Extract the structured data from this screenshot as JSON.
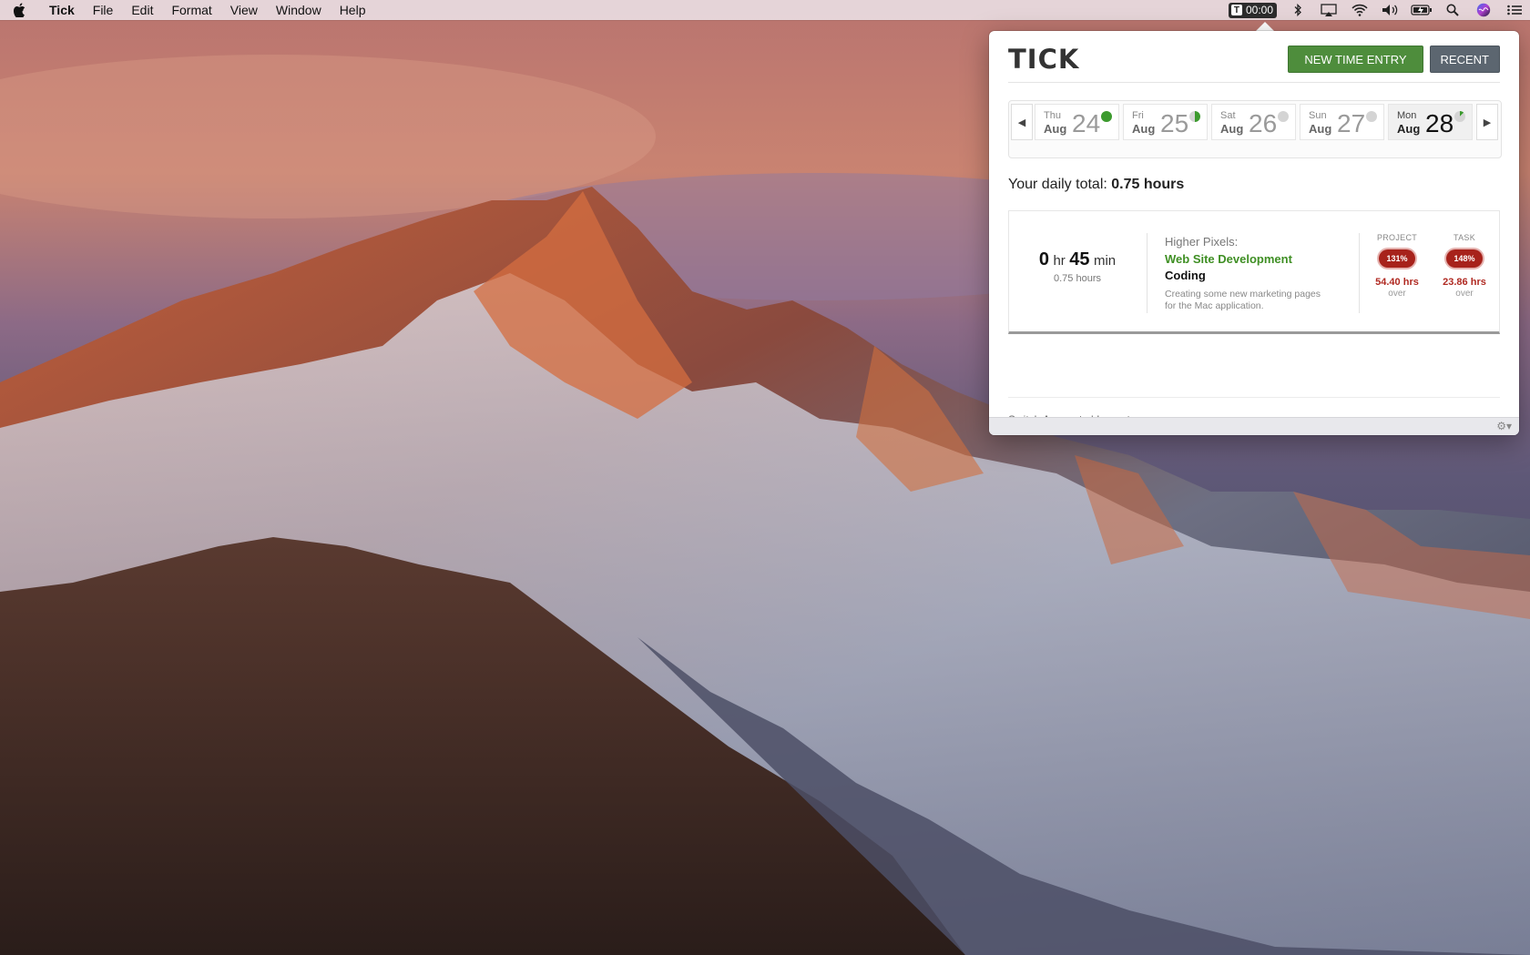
{
  "menubar": {
    "app_name": "Tick",
    "menus": [
      "File",
      "Edit",
      "Format",
      "View",
      "Window",
      "Help"
    ],
    "status_timer": "00:00",
    "status_icon_letter": "T",
    "icons": [
      "apple-logo-icon",
      "tick-timer-icon",
      "bluetooth-icon",
      "airplay-icon",
      "wifi-icon",
      "volume-icon",
      "battery-icon",
      "spotlight-search-icon",
      "siri-icon",
      "notification-center-icon"
    ]
  },
  "popover": {
    "logo": "TICK",
    "new_entry_label": "NEW TIME ENTRY",
    "recent_label": "RECENT",
    "days": [
      {
        "dow": "Thu",
        "month": "Aug",
        "day": "24",
        "status": "complete",
        "active": false
      },
      {
        "dow": "Fri",
        "month": "Aug",
        "day": "25",
        "status": "partial-half",
        "active": false
      },
      {
        "dow": "Sat",
        "month": "Aug",
        "day": "26",
        "status": "empty",
        "active": false
      },
      {
        "dow": "Sun",
        "month": "Aug",
        "day": "27",
        "status": "empty",
        "active": false
      },
      {
        "dow": "Mon",
        "month": "Aug",
        "day": "28",
        "status": "partial-small",
        "active": true
      }
    ],
    "daily_total_label": "Your daily total:",
    "daily_total_value": "0.75 hours",
    "entry": {
      "hours": "0",
      "hr_unit": "hr",
      "minutes": "45",
      "min_unit": "min",
      "decimal_hours": "0.75 hours",
      "client": "Higher Pixels:",
      "project": "Web Site Development",
      "task": "Coding",
      "note_line1": "Creating some new marketing pages",
      "note_line2": "for the Mac application.",
      "project_budget": {
        "label": "PROJECT",
        "percent": "131%",
        "over_value": "54.40 hrs",
        "over_label": "over"
      },
      "task_budget": {
        "label": "TASK",
        "percent": "148%",
        "over_value": "23.86 hrs",
        "over_label": "over"
      }
    },
    "footer": {
      "switch_accounts": "Switch Accounts",
      "separator": "|",
      "logout": "Logout"
    }
  },
  "colors": {
    "brand_green": "#4e8d3c",
    "project_link_green": "#3f8f24",
    "over_budget_red": "#a7221b",
    "recent_button_gray": "#5c6670"
  }
}
